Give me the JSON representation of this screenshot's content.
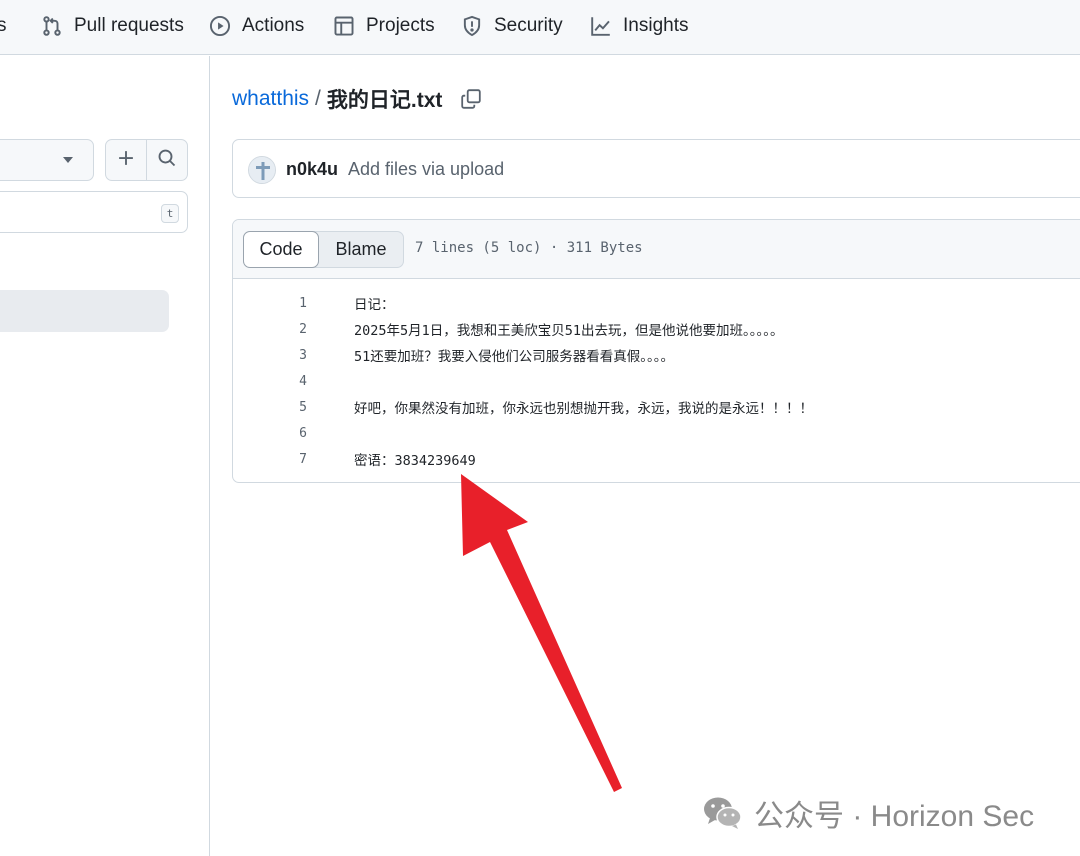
{
  "nav": {
    "partial_item": "s",
    "items": [
      {
        "label": "Pull requests",
        "icon": "git-pull-request-icon"
      },
      {
        "label": "Actions",
        "icon": "play-icon"
      },
      {
        "label": "Projects",
        "icon": "table-icon"
      },
      {
        "label": "Security",
        "icon": "shield-icon"
      },
      {
        "label": "Insights",
        "icon": "graph-icon"
      }
    ]
  },
  "sidebar": {
    "add_icon": "plus-icon",
    "search_icon": "search-icon",
    "filter_shortcut": "t"
  },
  "breadcrumb": {
    "repo": "whatthis",
    "separator": "/",
    "file": "我的日记.txt",
    "copy_icon": "copy-icon"
  },
  "commit": {
    "author": "n0k4u",
    "message": "Add files via upload"
  },
  "file_view": {
    "tab_code": "Code",
    "tab_blame": "Blame",
    "meta": "7 lines (5 loc) · 311 Bytes",
    "lines": [
      {
        "n": "1",
        "text": "日记："
      },
      {
        "n": "2",
        "text": "2025年5月1日，我想和王美欣宝贝51出去玩，但是他说他要加班。。。。。"
      },
      {
        "n": "3",
        "text": "51还要加班？我要入侵他们公司服务器看看真假。。。。"
      },
      {
        "n": "4",
        "text": ""
      },
      {
        "n": "5",
        "text": "好吧，你果然没有加班，你永远也别想抛开我，永远，我说的是永远！！！！"
      },
      {
        "n": "6",
        "text": ""
      },
      {
        "n": "7",
        "text": "密语：3834239649"
      }
    ]
  },
  "annotation_color": "#e8202a",
  "watermark": {
    "text": "公众号 · Horizon Sec",
    "icon": "wechat-icon"
  }
}
